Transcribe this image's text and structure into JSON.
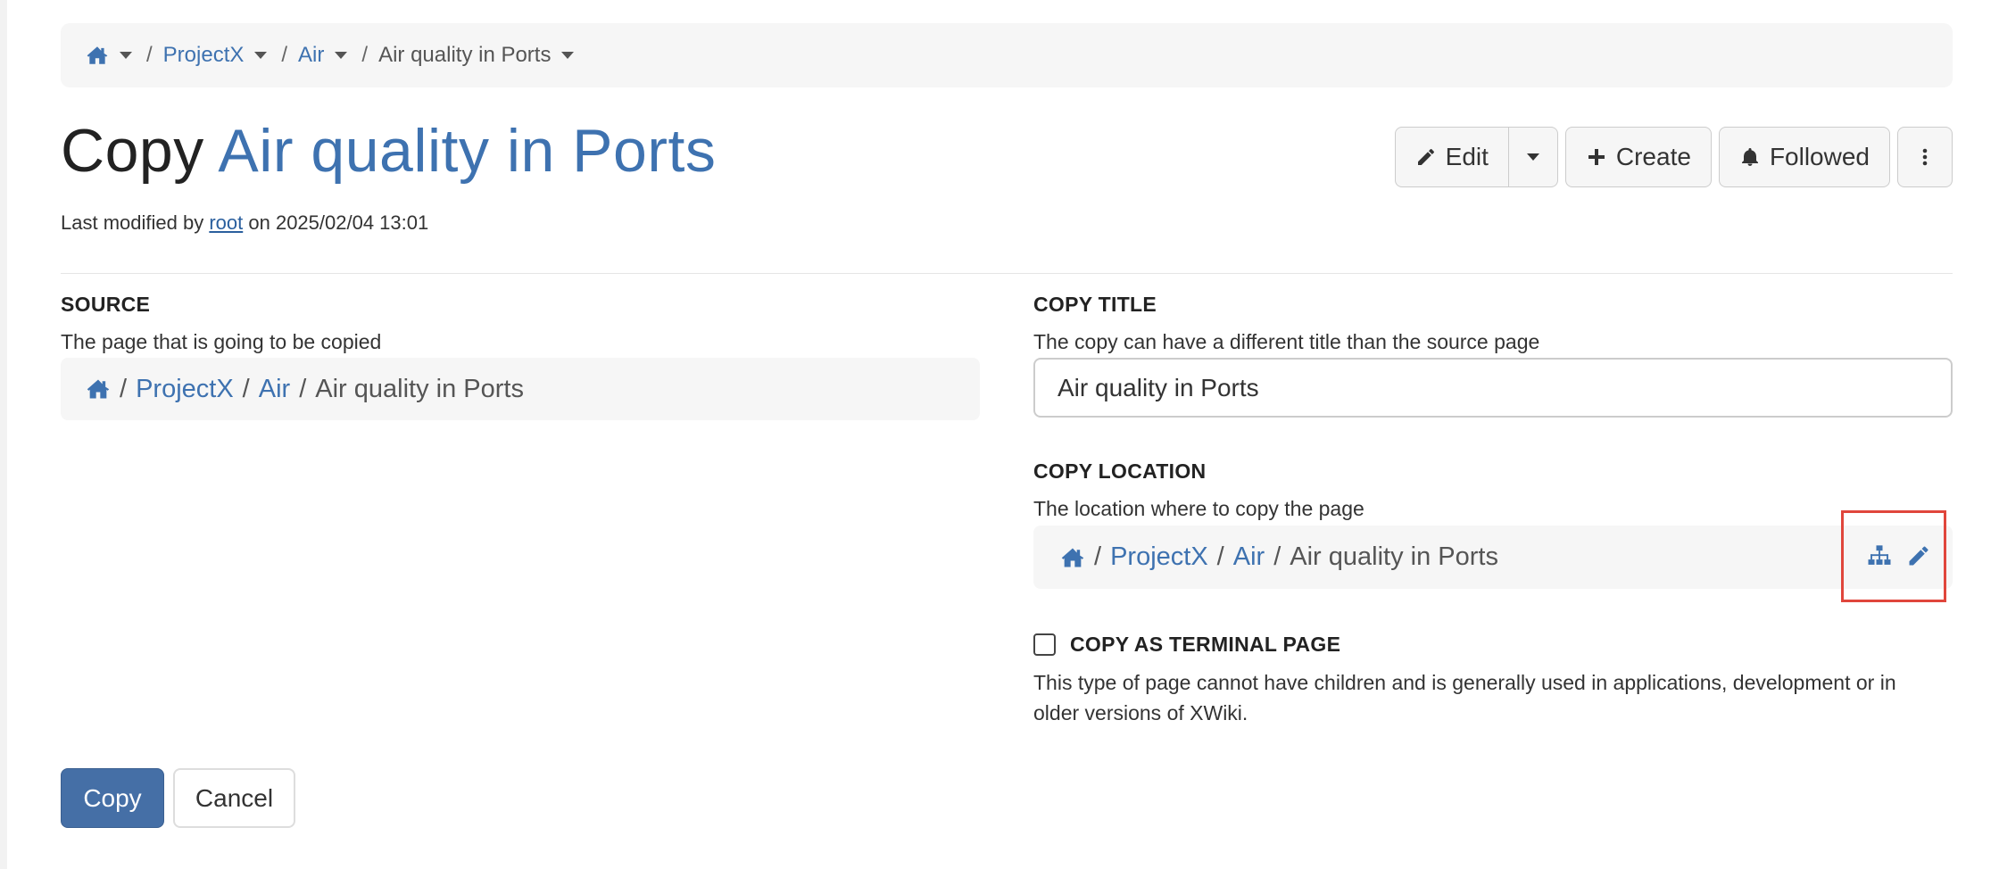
{
  "breadcrumb": {
    "items": [
      "ProjectX",
      "Air",
      "Air quality in Ports"
    ]
  },
  "title": {
    "prefix": "Copy",
    "document": "Air quality in Ports"
  },
  "meta": {
    "before": "Last modified by",
    "user": "root",
    "after": "on 2025/02/04 13:01"
  },
  "actions": {
    "edit": "Edit",
    "create": "Create",
    "followed": "Followed"
  },
  "source": {
    "label": "SOURCE",
    "hint": "The page that is going to be copied",
    "path": [
      "ProjectX",
      "Air",
      "Air quality in Ports"
    ]
  },
  "copy_title": {
    "label": "COPY TITLE",
    "hint": "The copy can have a different title than the source page",
    "value": "Air quality in Ports"
  },
  "copy_location": {
    "label": "COPY LOCATION",
    "hint": "The location where to copy the page",
    "path": [
      "ProjectX",
      "Air",
      "Air quality in Ports"
    ]
  },
  "terminal": {
    "label": "COPY AS TERMINAL PAGE",
    "hint_line1": "This type of page cannot have children and is generally used in applications, development or in",
    "hint_line2": "older versions of XWiki.",
    "checked": false
  },
  "buttons": {
    "copy": "Copy",
    "cancel": "Cancel"
  },
  "colors": {
    "link": "#3e72b0",
    "primary": "#456fa6",
    "highlight": "#e0463c"
  }
}
